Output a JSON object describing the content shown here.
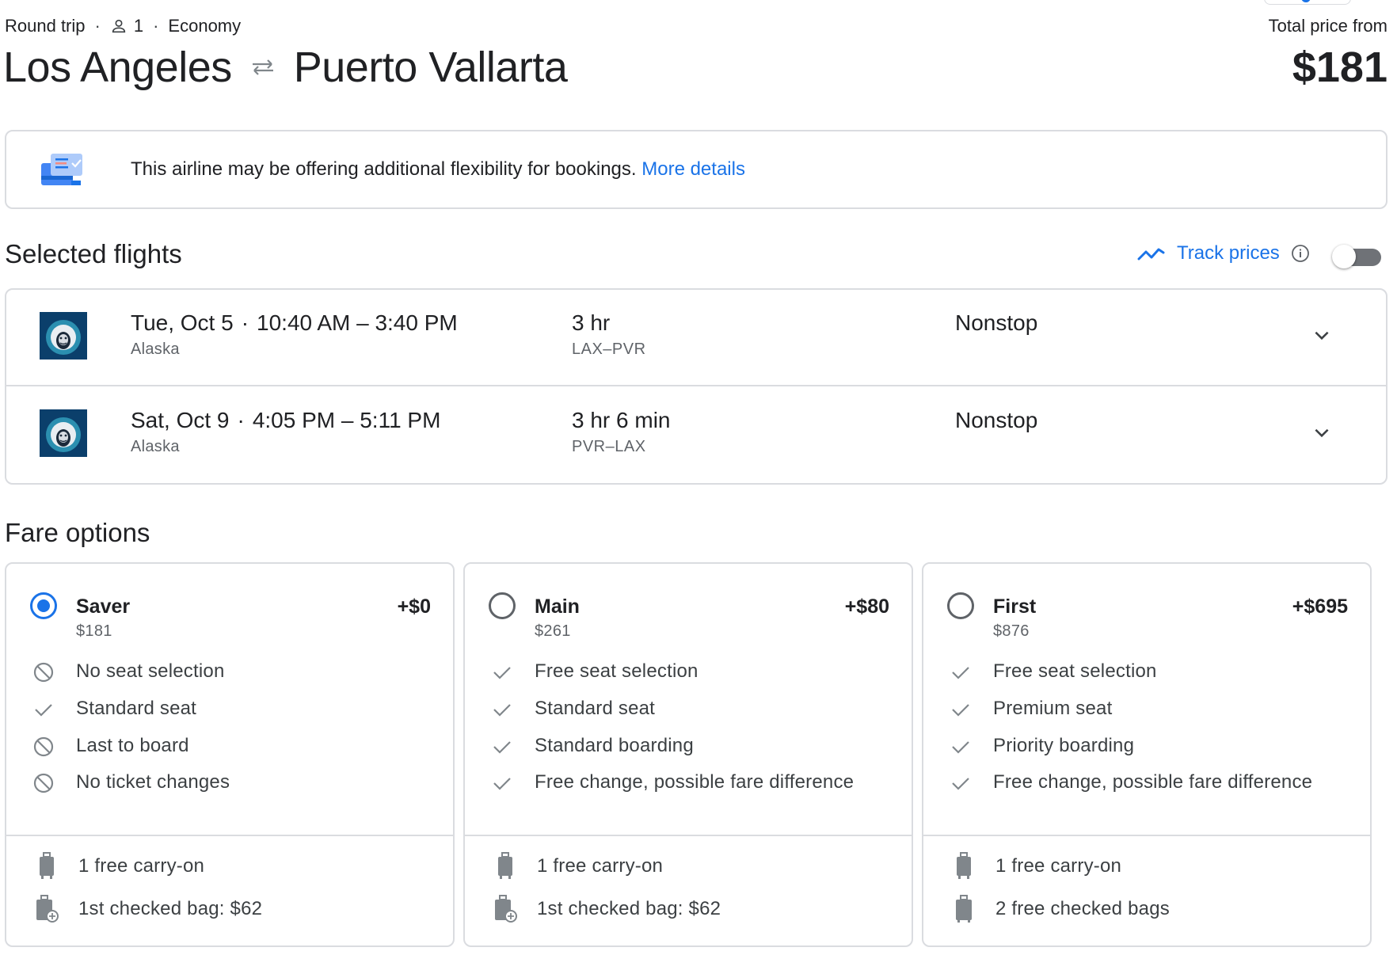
{
  "header": {
    "trip_type": "Round trip",
    "passengers": "1",
    "cabin": "Economy",
    "origin": "Los Angeles",
    "destination": "Puerto Vallarta",
    "price_label": "Total price from",
    "price": "$181"
  },
  "notice": {
    "text": "This airline may be offering additional flexibility for bookings.",
    "link": "More details"
  },
  "selected": {
    "title": "Selected flights",
    "track_label": "Track prices",
    "track_enabled": false
  },
  "flights": [
    {
      "date": "Tue, Oct 5",
      "times": "10:40 AM – 3:40 PM",
      "airline": "Alaska",
      "duration": "3 hr",
      "route": "LAX–PVR",
      "stops": "Nonstop"
    },
    {
      "date": "Sat, Oct 9",
      "times": "4:05 PM – 5:11 PM",
      "airline": "Alaska",
      "duration": "3 hr 6 min",
      "route": "PVR–LAX",
      "stops": "Nonstop"
    }
  ],
  "fares": {
    "title": "Fare options",
    "options": [
      {
        "name": "Saver",
        "total": "$181",
        "delta": "+$0",
        "selected": true,
        "features": [
          {
            "text": "No seat selection",
            "icon": "block-icon"
          },
          {
            "text": "Standard seat",
            "icon": "check-icon"
          },
          {
            "text": "Last to board",
            "icon": "block-icon"
          },
          {
            "text": "No ticket changes",
            "icon": "block-icon"
          }
        ],
        "bags": [
          {
            "text": "1 free carry-on",
            "icon": "carry-on-icon"
          },
          {
            "text": "1st checked bag: $62",
            "icon": "checked-bag-fee-icon"
          }
        ]
      },
      {
        "name": "Main",
        "total": "$261",
        "delta": "+$80",
        "selected": false,
        "features": [
          {
            "text": "Free seat selection",
            "icon": "check-icon"
          },
          {
            "text": "Standard seat",
            "icon": "check-icon"
          },
          {
            "text": "Standard boarding",
            "icon": "check-icon"
          },
          {
            "text": "Free change, possible fare difference",
            "icon": "check-icon"
          }
        ],
        "bags": [
          {
            "text": "1 free carry-on",
            "icon": "carry-on-icon"
          },
          {
            "text": "1st checked bag: $62",
            "icon": "checked-bag-fee-icon"
          }
        ]
      },
      {
        "name": "First",
        "total": "$876",
        "delta": "+$695",
        "selected": false,
        "features": [
          {
            "text": "Free seat selection",
            "icon": "check-icon"
          },
          {
            "text": "Premium seat",
            "icon": "check-icon"
          },
          {
            "text": "Priority boarding",
            "icon": "check-icon"
          },
          {
            "text": "Free change, possible fare difference",
            "icon": "check-icon"
          }
        ],
        "bags": [
          {
            "text": "1 free carry-on",
            "icon": "carry-on-icon"
          },
          {
            "text": "2 free checked bags",
            "icon": "checked-bag-icon"
          }
        ]
      }
    ]
  },
  "colors": {
    "accent": "#1a73e8",
    "text": "#202124",
    "muted": "#5f6368",
    "border": "#dadce0",
    "airline_logo_bg": "#0b3f6b"
  }
}
